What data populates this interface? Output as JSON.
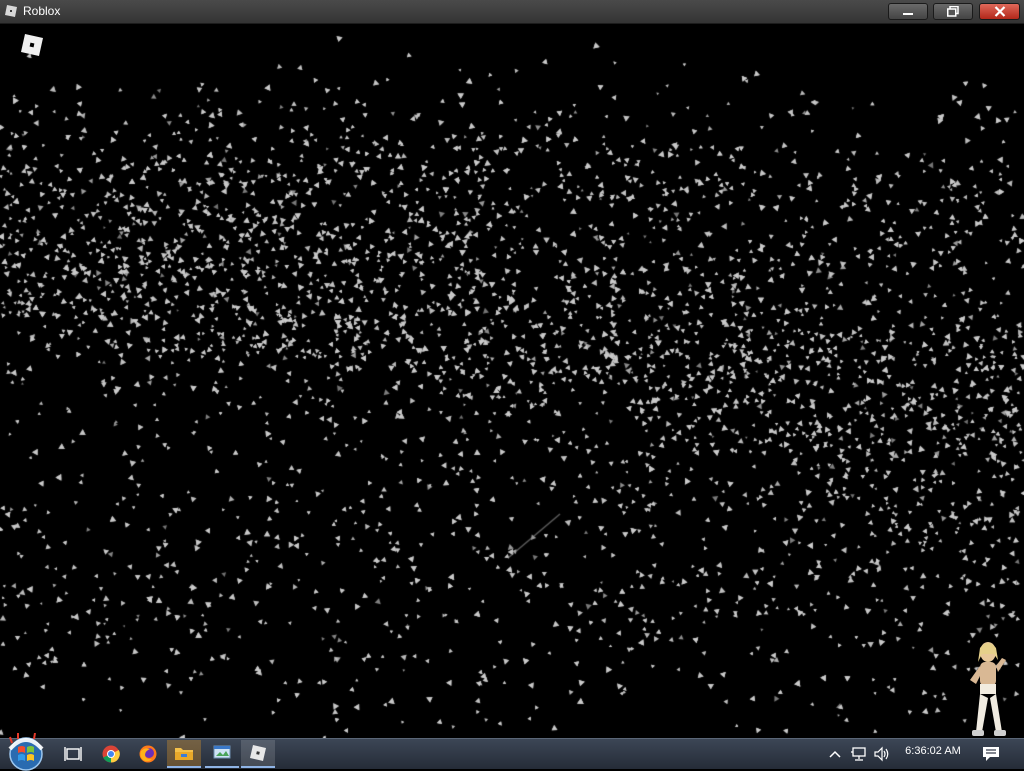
{
  "window": {
    "title": "Roblox",
    "icon": "roblox-logo-icon",
    "controls": [
      "minimize-icon",
      "maximize-icon",
      "close-icon"
    ]
  },
  "game": {
    "menu_icon": "roblox-menu-icon",
    "scene": "dark wireframe particle field"
  },
  "taskbar": {
    "start": "windows-start-icon",
    "apps": [
      {
        "icon": "task-view-icon"
      },
      {
        "icon": "chrome-icon"
      },
      {
        "icon": "firefox-icon"
      },
      {
        "icon": "file-explorer-icon"
      },
      {
        "icon": "window-capture-icon"
      },
      {
        "icon": "roblox-icon"
      }
    ],
    "tray": {
      "icons": [
        "chevron-up-icon",
        "network-icon",
        "volume-icon",
        "notification-icon"
      ],
      "clock": "6:36:02 AM"
    }
  },
  "colors": {
    "titlebar": "#3c3c3c",
    "close_button": "#c8382a",
    "taskbar": "#2e3644",
    "particles": "#c9c9c9"
  }
}
